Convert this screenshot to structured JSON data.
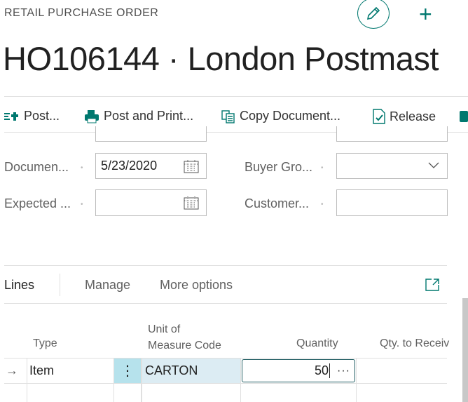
{
  "header": {
    "caption": "RETAIL PURCHASE ORDER",
    "title": "HO106144 · London Postmast",
    "edit_icon": "pencil-icon",
    "new_icon": "plus-icon"
  },
  "actions": [
    {
      "label": "Post...",
      "icon": "post-icon"
    },
    {
      "label": "Post and Print...",
      "icon": "printer-icon"
    },
    {
      "label": "Copy Document...",
      "icon": "copy-icon"
    },
    {
      "label": "Release",
      "icon": "release-icon"
    }
  ],
  "fields": {
    "document_date": {
      "label": "Documen...",
      "value": "5/23/2020"
    },
    "expected_date": {
      "label": "Expected ...",
      "value": ""
    },
    "buyer_group": {
      "label": "Buyer Gro...",
      "value": ""
    },
    "customer": {
      "label": "Customer...",
      "value": ""
    }
  },
  "lines": {
    "tabs": [
      "Lines",
      "Manage",
      "More options"
    ],
    "columns": {
      "type": "Type",
      "uom_1": "Unit of",
      "uom_2": "Measure Code",
      "quantity": "Quantity",
      "qty_receive": "Qty. to Receiv"
    },
    "rows": [
      {
        "type": "Item",
        "uom": "CARTON",
        "quantity": "50"
      }
    ]
  },
  "colors": {
    "accent": "#00786f",
    "selected_cell": "#dcecf3",
    "dots_cell": "#b6e2ec"
  }
}
